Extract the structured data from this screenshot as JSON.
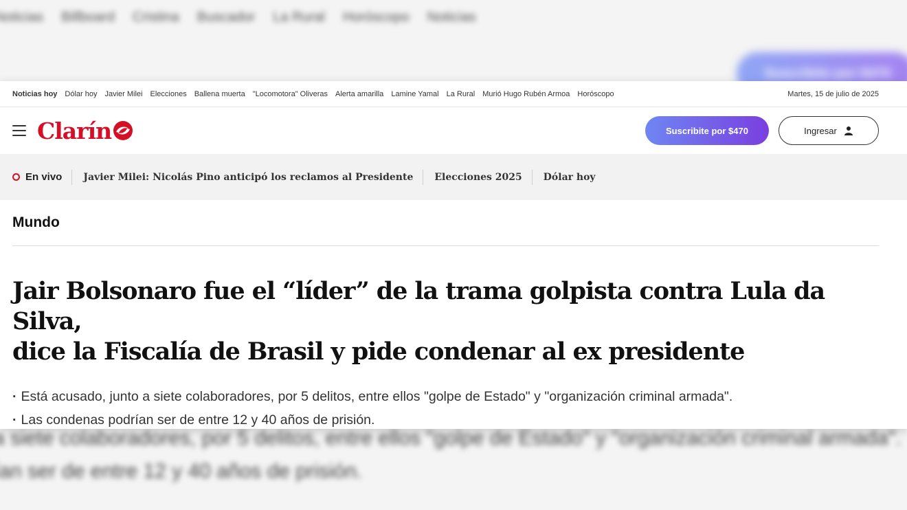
{
  "backdrop": {
    "nav": [
      "Noticias",
      "Billboard",
      "Cristina",
      "Buscador",
      "La Rural",
      "Horóscopo",
      "Noticias"
    ],
    "cta_label": "Suscribite por $470",
    "bottom_lines": [
      "a siete colaboradores, por 5 delitos, entre ellos \"golpe de Estado\" y \"organización criminal armada\".",
      "ían ser de entre 12 y 40 años de prisión."
    ]
  },
  "topbar": {
    "lead": "Noticias hoy",
    "items": [
      "Dólar hoy",
      "Javier Milei",
      "Elecciones",
      "Ballena muerta",
      "\"Locomotora\" Oliveras",
      "Alerta amarilla",
      "Lamine Yamal",
      "La Rural",
      "Murió Hugo Rubén Armoa",
      "Horóscopo"
    ],
    "date": "Martes, 15 de julio de 2025"
  },
  "header": {
    "logo_text": "Clarín",
    "subscribe_label": "Suscribite por $470",
    "login_label": "Ingresar",
    "brand_color": "#d50f25"
  },
  "livebar": {
    "live_label": "En vivo",
    "links": [
      "Javier Milei: Nicolás Pino anticipó los reclamos al Presidente",
      "Elecciones 2025",
      "Dólar hoy"
    ]
  },
  "article": {
    "section": "Mundo",
    "headline_line1": "Jair Bolsonaro fue el “líder” de la trama golpista contra Lula da Silva,",
    "headline_line2": "dice la Fiscalía de Brasil y pide condenar al ex presidente",
    "bullets": [
      "Está acusado, junto a siete colaboradores, por 5 delitos, entre ellos \"golpe de Estado\" y \"organización criminal armada\".",
      "Las condenas podrían ser de entre 12 y 40 años de prisión."
    ]
  }
}
